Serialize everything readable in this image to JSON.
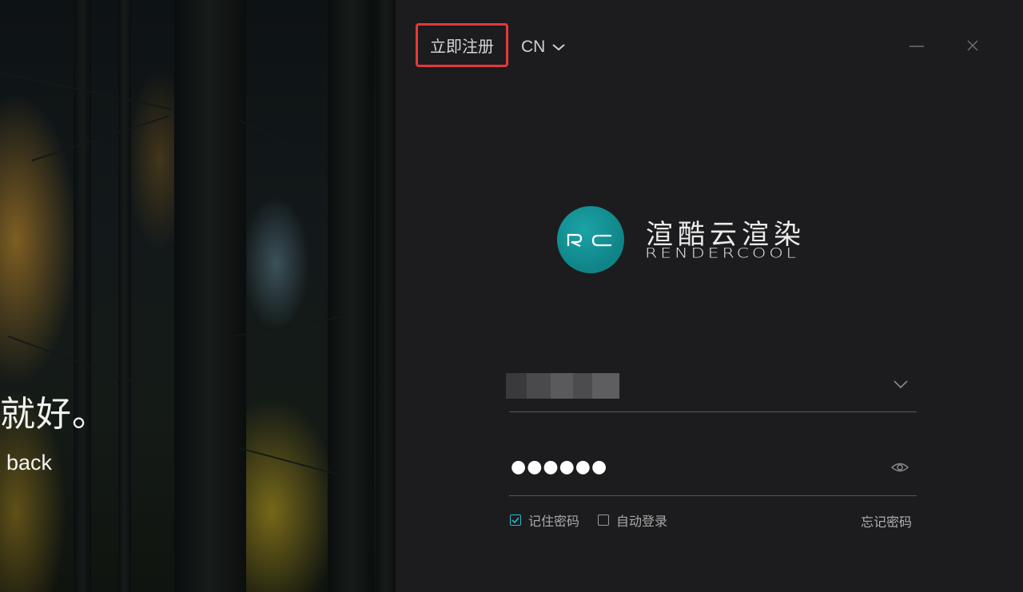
{
  "slogan": {
    "cn": "就好。",
    "en": "back"
  },
  "header": {
    "register_label": "立即注册",
    "language_label": "CN"
  },
  "logo": {
    "mark_text": "RC",
    "name_cn": "渲酷云渲染",
    "name_en": "RENDERCOOL",
    "accent_color": "#12949a"
  },
  "form": {
    "username_value_obscured": true,
    "password_value": "●●●●●●",
    "remember_label": "记住密码",
    "remember_checked": true,
    "autologin_label": "自动登录",
    "autologin_checked": false,
    "forgot_label": "忘记密码"
  },
  "colors": {
    "highlight_box": "#e5393a",
    "checkbox_accent": "#2bb9c5",
    "panel_bg": "#1c1c1e"
  }
}
